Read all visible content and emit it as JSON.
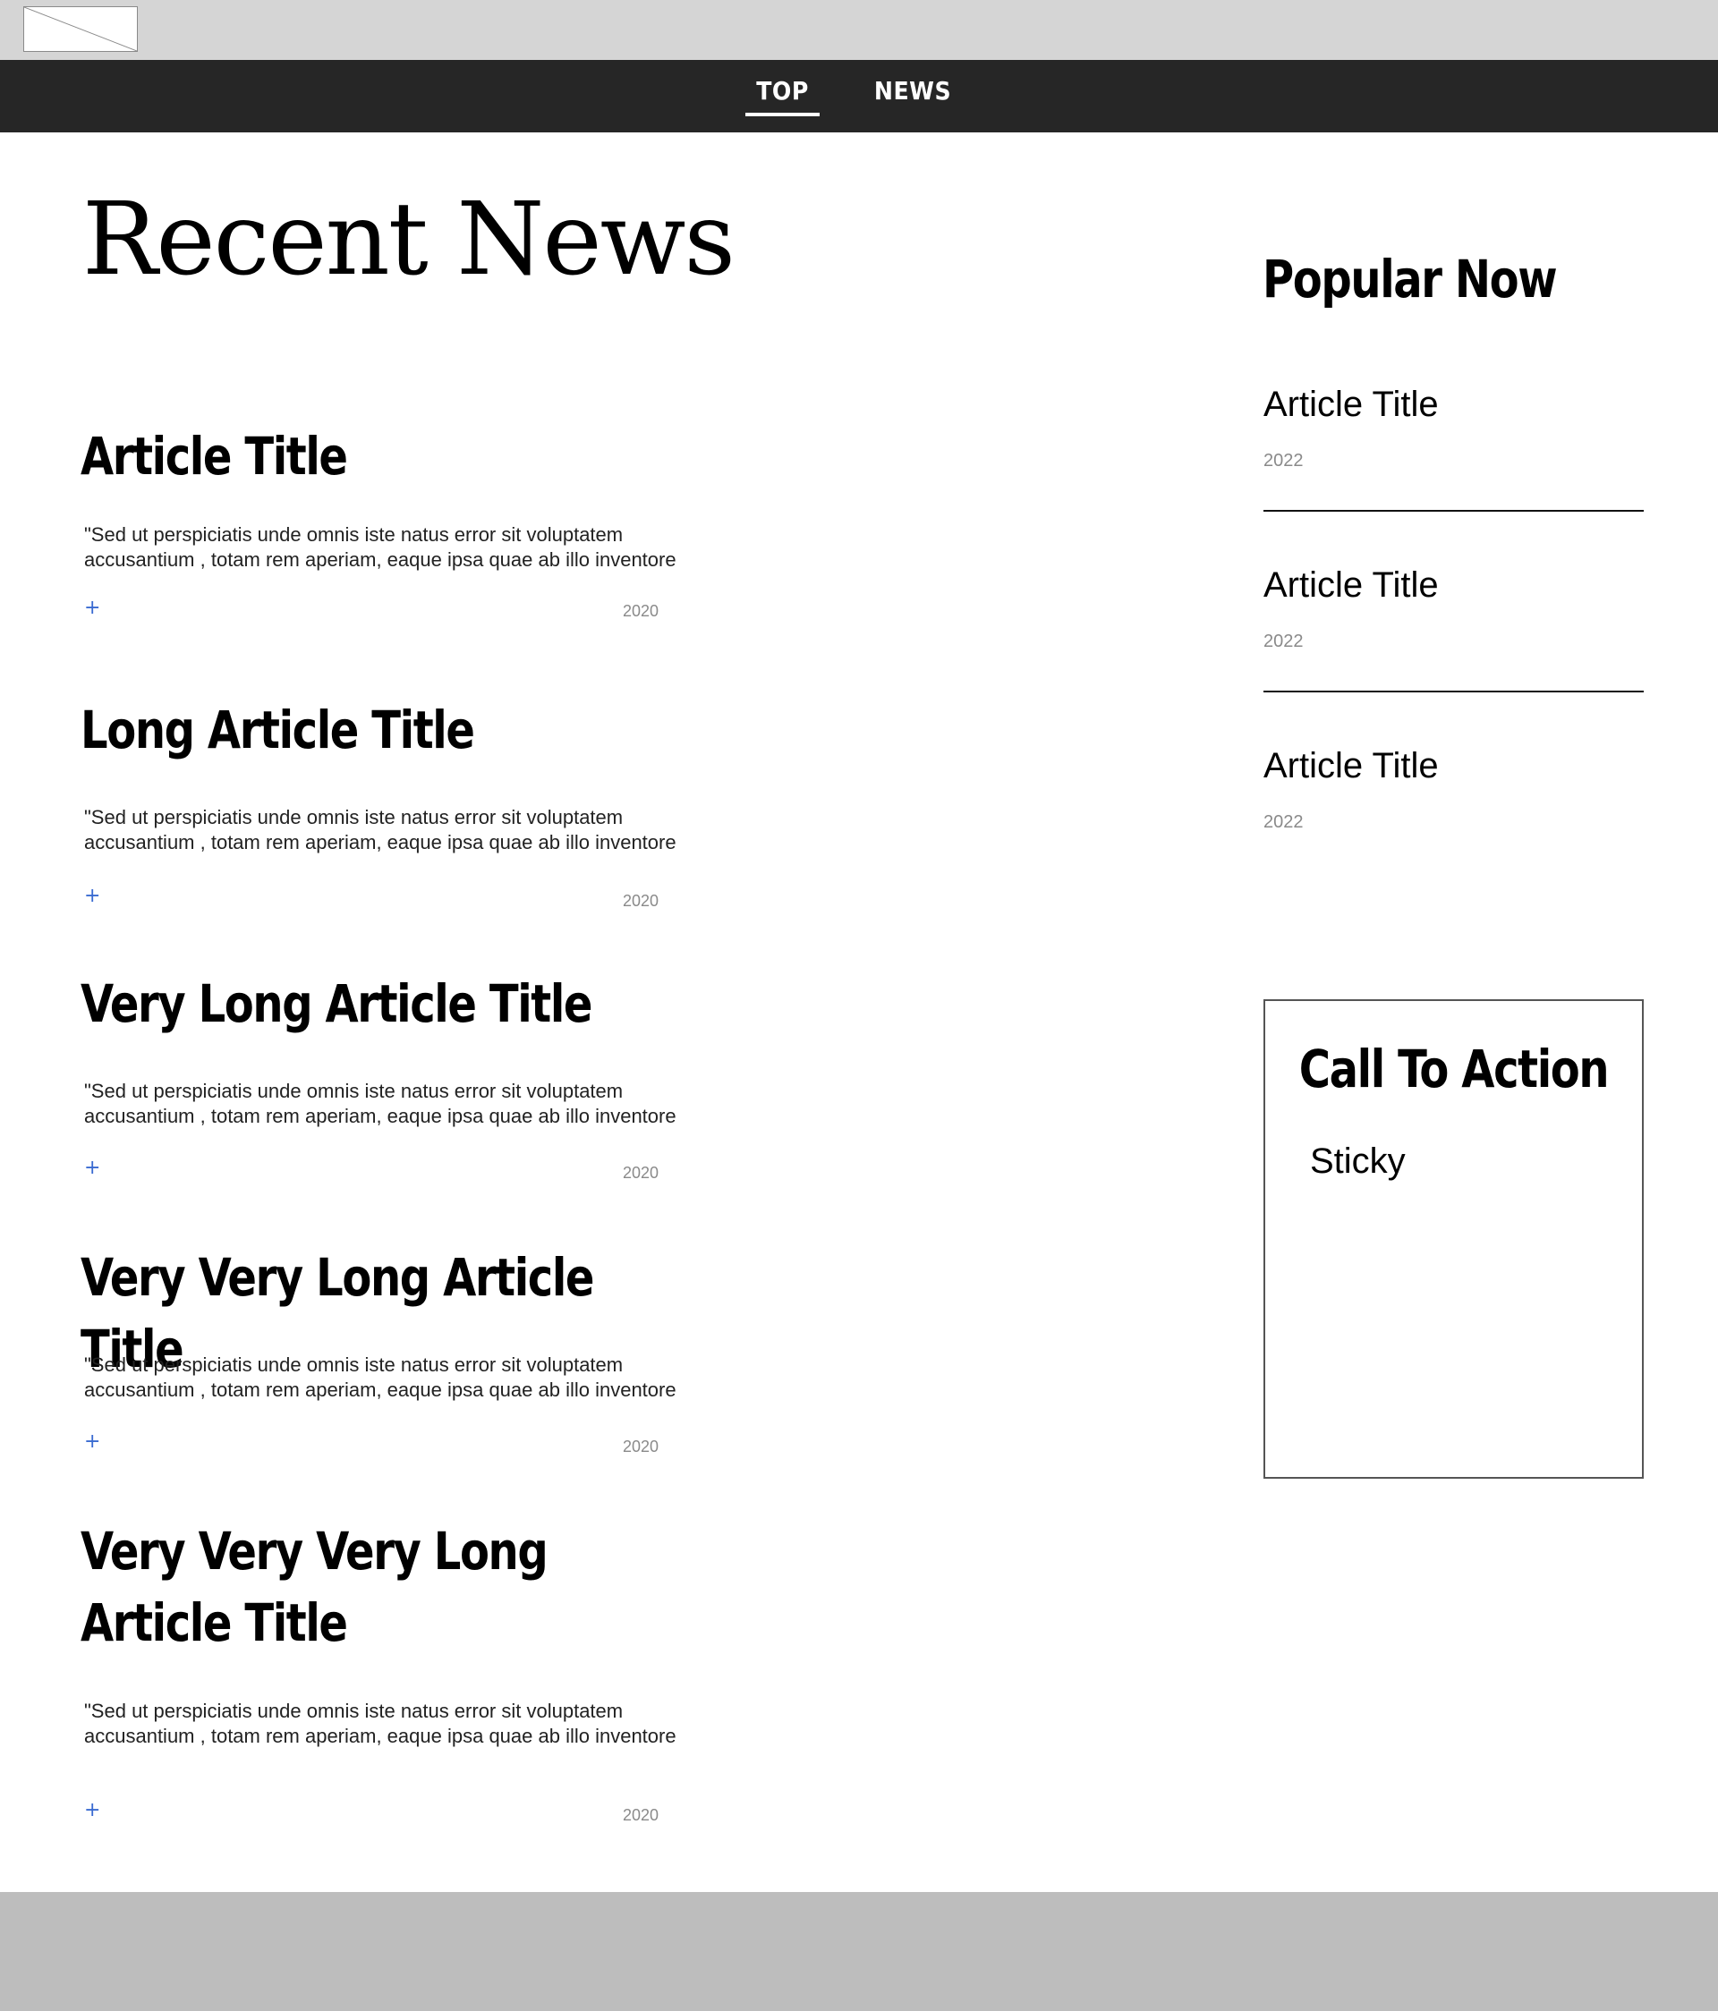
{
  "header": {
    "logo": "logo-placeholder"
  },
  "nav": {
    "items": [
      {
        "label": "TOP",
        "active": true
      },
      {
        "label": "NEWS",
        "active": false
      }
    ]
  },
  "main": {
    "title": "Recent News",
    "articles": [
      {
        "title": "Article Title",
        "excerpt": "\"Sed ut perspiciatis unde omnis iste natus error sit voluptatem accusantium , totam rem aperiam, eaque ipsa quae ab illo inventore",
        "more": "+",
        "year": "2020"
      },
      {
        "title": "Long Article Title",
        "excerpt": "\"Sed ut perspiciatis unde omnis iste natus error sit voluptatem accusantium , totam rem aperiam, eaque ipsa quae ab illo inventore",
        "more": "+",
        "year": "2020"
      },
      {
        "title": "Very Long Article Title",
        "excerpt": "\"Sed ut perspiciatis unde omnis iste natus error sit voluptatem accusantium , totam rem aperiam, eaque ipsa quae ab illo inventore",
        "more": "+",
        "year": "2020"
      },
      {
        "title": "Very Very Long Article Title",
        "excerpt": "\"Sed ut perspiciatis unde omnis iste natus error sit voluptatem accusantium , totam rem aperiam, eaque ipsa quae ab illo inventore",
        "more": "+",
        "year": "2020"
      },
      {
        "title_line1": "Very Very Very Long",
        "title_line2": "Article Title",
        "excerpt": "\"Sed ut perspiciatis unde omnis iste natus error sit voluptatem accusantium , totam rem aperiam, eaque ipsa quae ab illo inventore",
        "more": "+",
        "year": "2020"
      }
    ]
  },
  "sidebar": {
    "heading": "Popular Now",
    "items": [
      {
        "title": "Article Title",
        "year": "2022"
      },
      {
        "title": "Article Title",
        "year": "2022"
      },
      {
        "title": "Article Title",
        "year": "2022"
      }
    ],
    "cta": {
      "title": "Call To Action",
      "body": "Sticky"
    }
  },
  "colors": {
    "header_bg": "#d5d5d5",
    "nav_bg": "#262626",
    "link": "#3a6bd1",
    "meta": "#8a8a8a",
    "footer_bg": "#bdbdbd"
  }
}
